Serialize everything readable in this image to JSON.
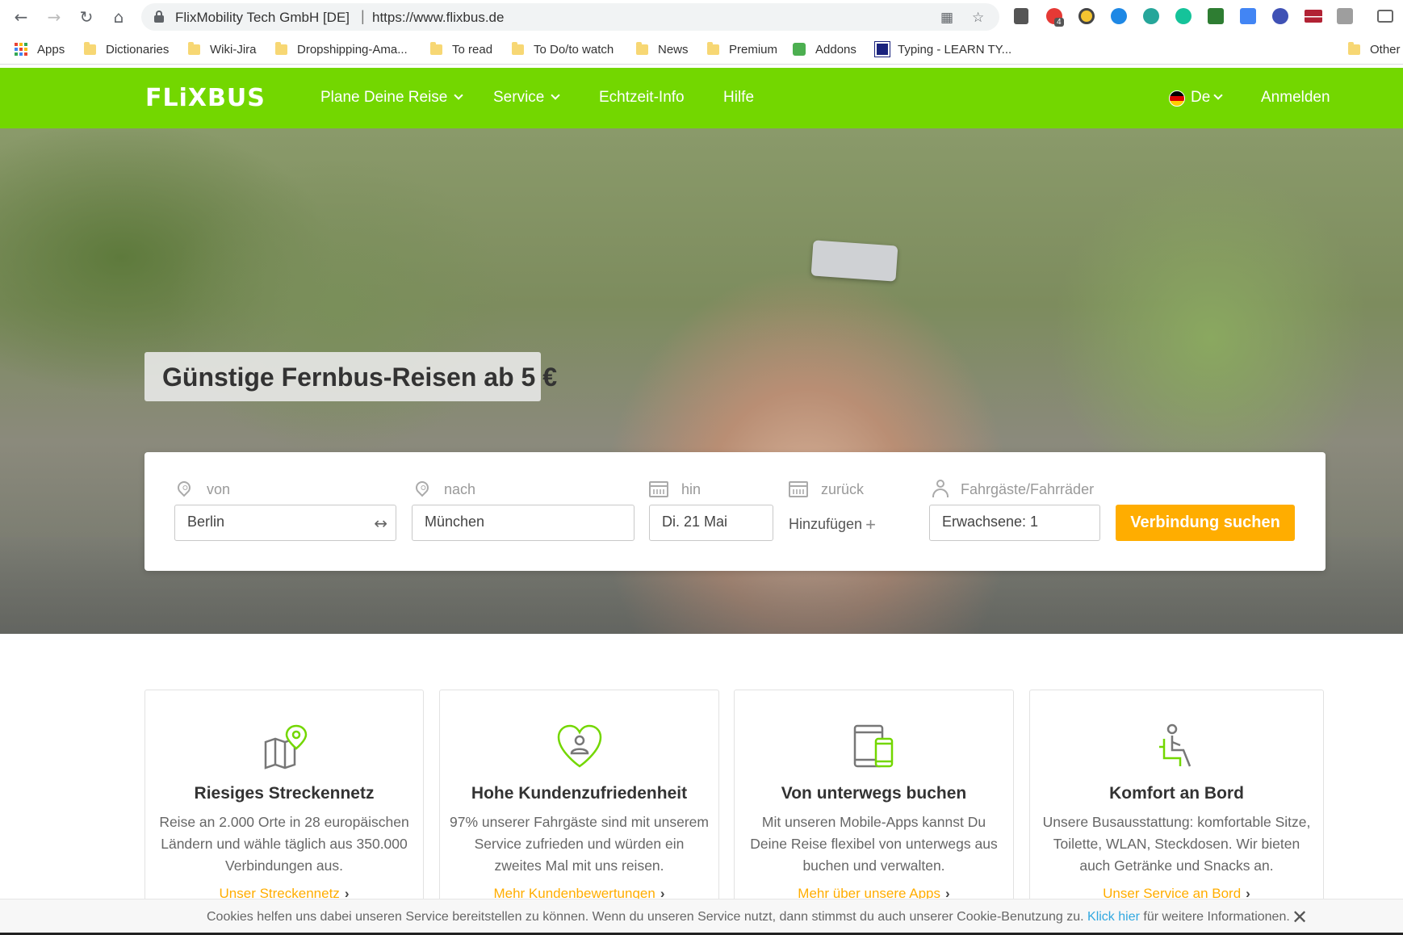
{
  "browser": {
    "site_name": "FlixMobility Tech GmbH [DE]",
    "url": "https://www.flixbus.de",
    "bookmarks": [
      "Apps",
      "Dictionaries",
      "Wiki-Jira",
      "Dropshipping-Ama...",
      "To read",
      "To Do/to watch",
      "News",
      "Premium",
      "Addons",
      "Typing - LEARN TY...",
      "Other"
    ],
    "extension_badge": "4"
  },
  "nav": {
    "logo": "FLiXBUS",
    "plan": "Plane Deine Reise",
    "service": "Service",
    "realtime": "Echtzeit-Info",
    "help": "Hilfe",
    "language": "De",
    "login": "Anmelden"
  },
  "hero": {
    "tagline": "Günstige Fernbus-Reisen ab 5 €"
  },
  "search": {
    "from_label": "von",
    "from_value": "Berlin",
    "to_label": "nach",
    "to_value": "München",
    "depart_label": "hin",
    "depart_value": "Di. 21 Mai",
    "return_label": "zurück",
    "return_add": "Hinzufügen",
    "passengers_label": "Fahrgäste/Fahrräder",
    "passengers_value": "Erwachsene: 1",
    "submit": "Verbindung suchen"
  },
  "features": [
    {
      "title": "Riesiges Streckennetz",
      "text": "Reise an 2.000 Orte in 28 europäischen Ländern und wähle täglich aus 350.000 Verbindungen aus.",
      "link": "Unser Streckennetz"
    },
    {
      "title": "Hohe Kundenzufriedenheit",
      "text": "97% unserer Fahrgäste sind mit unserem Service zufrieden und würden ein zweites Mal mit uns reisen.",
      "link": "Mehr Kundenbewertungen"
    },
    {
      "title": "Von unterwegs buchen",
      "text": "Mit unseren Mobile-Apps kannst Du Deine Reise flexibel von unterwegs aus buchen und verwalten.",
      "link": "Mehr über unsere Apps"
    },
    {
      "title": "Komfort an Bord",
      "text": "Unsere Busausstattung: komfortable Sitze, Toilette, WLAN, Steckdosen. Wir bieten auch Getränke und Snacks an.",
      "link": "Unser Service an Bord"
    }
  ],
  "cookie": {
    "text_before": "Cookies helfen uns dabei unseren Service bereitstellen zu können. Wenn du unseren Service nutzt, dann stimmst du auch unserer Cookie-Benutzung zu.",
    "link": "Klick hier",
    "text_after": "für weitere Informationen."
  },
  "colors": {
    "brand_green": "#73d700",
    "accent_orange": "#ffad00",
    "link_blue": "#31a8e0"
  }
}
